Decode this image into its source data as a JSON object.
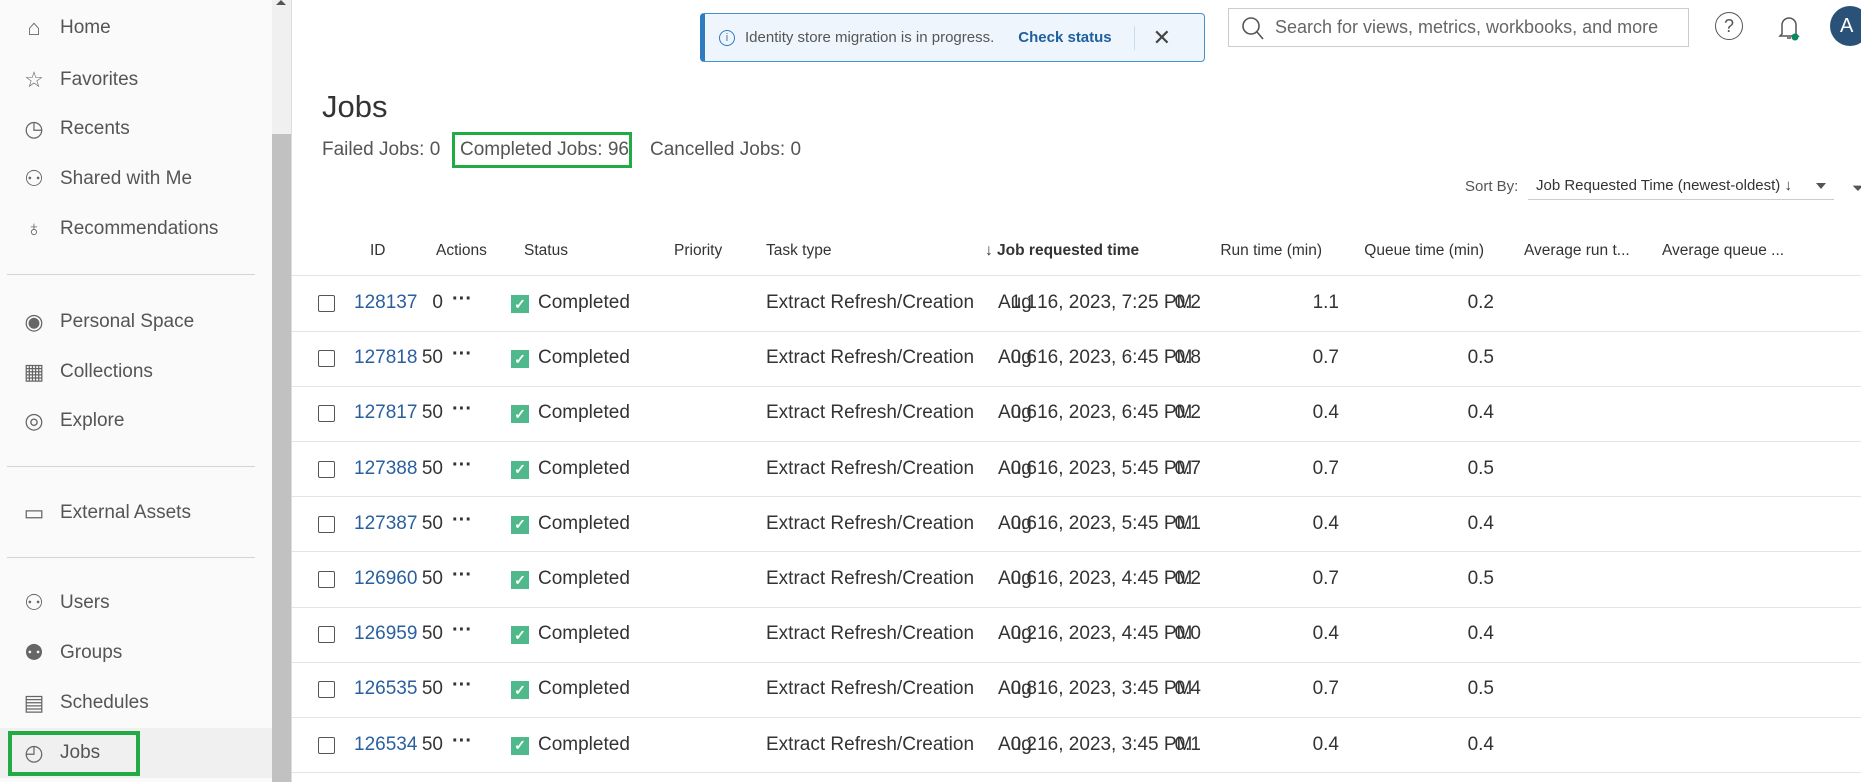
{
  "sidebar": {
    "items": [
      {
        "label": "Home",
        "icon": "home-icon"
      },
      {
        "label": "Favorites",
        "icon": "star-icon"
      },
      {
        "label": "Recents",
        "icon": "clock-history-icon"
      },
      {
        "label": "Shared with Me",
        "icon": "shared-users-icon"
      },
      {
        "label": "Recommendations",
        "icon": "lightbulb-icon"
      },
      {
        "label": "Personal Space",
        "icon": "user-circle-icon"
      },
      {
        "label": "Collections",
        "icon": "collections-icon"
      },
      {
        "label": "Explore",
        "icon": "compass-icon"
      },
      {
        "label": "External Assets",
        "icon": "archive-box-icon"
      },
      {
        "label": "Users",
        "icon": "users-icon"
      },
      {
        "label": "Groups",
        "icon": "groups-icon"
      },
      {
        "label": "Schedules",
        "icon": "calendar-icon"
      },
      {
        "label": "Jobs",
        "icon": "jobs-clock-icon",
        "active": true
      }
    ]
  },
  "banner": {
    "message": "Identity store migration is in progress.",
    "action": "Check status"
  },
  "search": {
    "placeholder": "Search for views, metrics, workbooks, and more"
  },
  "avatar": {
    "initial": "A"
  },
  "page": {
    "title": "Jobs",
    "failed": "Failed Jobs: 0",
    "completed": "Completed Jobs: 96",
    "cancelled": "Cancelled Jobs: 0",
    "sort_label": "Sort By:",
    "sort_value": "Job Requested Time (newest-oldest) ↓"
  },
  "table": {
    "headers": {
      "id": "ID",
      "actions": "Actions",
      "status": "Status",
      "priority": "Priority",
      "task": "Task type",
      "time": "↓ Job requested time",
      "run": "Run time (min)",
      "queue": "Queue time (min)",
      "avg_run": "Average run t...",
      "avg_queue": "Average queue ..."
    },
    "rows": [
      {
        "id": "128137",
        "status": "Completed",
        "priority": "0",
        "task": "Extract Refresh/Creation",
        "time": "Aug 16, 2023, 7:25 PM",
        "run": "1.1",
        "queue": "0.2",
        "avg_run": "1.1",
        "avg_queue": "0.2"
      },
      {
        "id": "127818",
        "status": "Completed",
        "priority": "50",
        "task": "Extract Refresh/Creation",
        "time": "Aug 16, 2023, 6:45 PM",
        "run": "0.6",
        "queue": "0.8",
        "avg_run": "0.7",
        "avg_queue": "0.5"
      },
      {
        "id": "127817",
        "status": "Completed",
        "priority": "50",
        "task": "Extract Refresh/Creation",
        "time": "Aug 16, 2023, 6:45 PM",
        "run": "0.6",
        "queue": "0.2",
        "avg_run": "0.4",
        "avg_queue": "0.4"
      },
      {
        "id": "127388",
        "status": "Completed",
        "priority": "50",
        "task": "Extract Refresh/Creation",
        "time": "Aug 16, 2023, 5:45 PM",
        "run": "0.6",
        "queue": "0.7",
        "avg_run": "0.7",
        "avg_queue": "0.5"
      },
      {
        "id": "127387",
        "status": "Completed",
        "priority": "50",
        "task": "Extract Refresh/Creation",
        "time": "Aug 16, 2023, 5:45 PM",
        "run": "0.6",
        "queue": "0.1",
        "avg_run": "0.4",
        "avg_queue": "0.4"
      },
      {
        "id": "126960",
        "status": "Completed",
        "priority": "50",
        "task": "Extract Refresh/Creation",
        "time": "Aug 16, 2023, 4:45 PM",
        "run": "0.6",
        "queue": "0.2",
        "avg_run": "0.7",
        "avg_queue": "0.5"
      },
      {
        "id": "126959",
        "status": "Completed",
        "priority": "50",
        "task": "Extract Refresh/Creation",
        "time": "Aug 16, 2023, 4:45 PM",
        "run": "0.2",
        "queue": "0.0",
        "avg_run": "0.4",
        "avg_queue": "0.4"
      },
      {
        "id": "126535",
        "status": "Completed",
        "priority": "50",
        "task": "Extract Refresh/Creation",
        "time": "Aug 16, 2023, 3:45 PM",
        "run": "0.8",
        "queue": "0.4",
        "avg_run": "0.7",
        "avg_queue": "0.5"
      },
      {
        "id": "126534",
        "status": "Completed",
        "priority": "50",
        "task": "Extract Refresh/Creation",
        "time": "Aug 16, 2023, 3:45 PM",
        "run": "0.2",
        "queue": "0.1",
        "avg_run": "0.4",
        "avg_queue": "0.4"
      }
    ]
  },
  "colors": {
    "accent": "#2a5f9e",
    "highlight": "#22aa44",
    "status_ok": "#4fb98c",
    "avatar": "#2a5177"
  }
}
